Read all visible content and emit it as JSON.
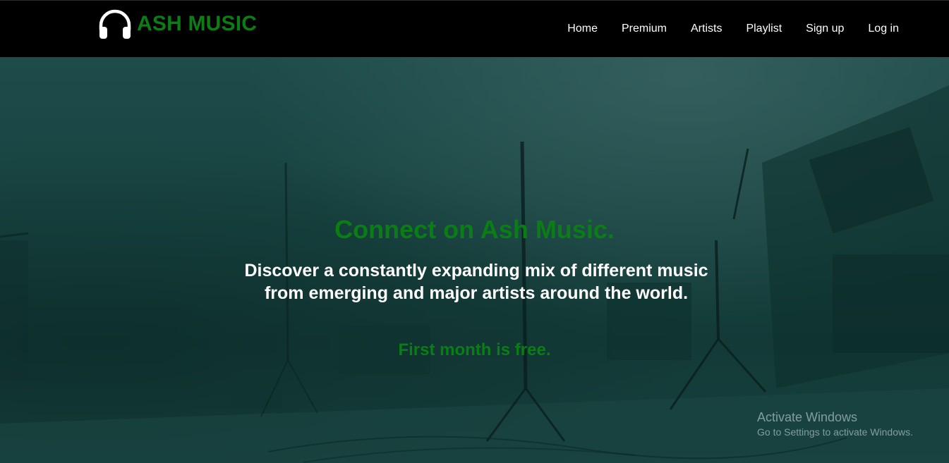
{
  "brand": {
    "name": "ASH MUSIC",
    "icon": "headphones-icon",
    "color": "#0a7d15"
  },
  "nav": {
    "items": [
      "Home",
      "Premium",
      "Artists",
      "Playlist",
      "Sign up",
      "Log in"
    ]
  },
  "hero": {
    "headline": "Connect on Ash Music.",
    "tagline": "Discover a constantly expanding mix of different music from emerging and major artists around the world.",
    "offer": "First month is free."
  },
  "watermark": {
    "title": "Activate Windows",
    "subtitle": "Go to Settings to activate Windows."
  }
}
